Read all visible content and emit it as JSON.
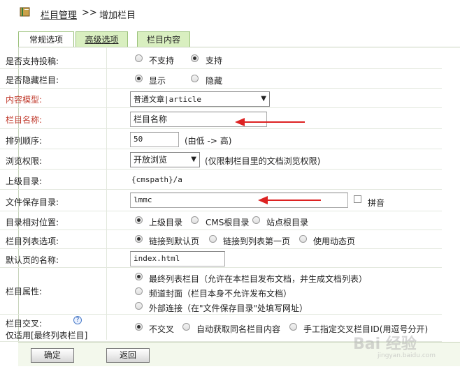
{
  "breadcrumb": {
    "section": "栏目管理",
    "separator": ">>",
    "current": "增加栏目"
  },
  "tabs": [
    "常规选项",
    "高级选项",
    "栏目内容"
  ],
  "rows": {
    "submit": {
      "label": "是否支持投稿:",
      "options": [
        "不支持",
        "支持"
      ]
    },
    "hidden": {
      "label": "是否隐藏栏目:",
      "options": [
        "显示",
        "隐藏"
      ]
    },
    "model": {
      "label": "内容模型:",
      "value": "普通文章|article"
    },
    "name": {
      "label": "栏目名称:",
      "value": "栏目名称"
    },
    "order": {
      "label": "排列顺序:",
      "value": "50",
      "hint": "(由低 -> 高)"
    },
    "perm": {
      "label": "浏览权限:",
      "value": "开放浏览",
      "hint": "(仅限制栏目里的文档浏览权限)"
    },
    "parent": {
      "label": "上级目录:",
      "value": "{cmspath}/a"
    },
    "dir": {
      "label": "文件保存目录:",
      "value": "lmmc",
      "pinyin": "拼音"
    },
    "relpos": {
      "label": "目录相对位置:",
      "options": [
        "上级目录",
        "CMS根目录",
        "站点根目录"
      ]
    },
    "listopt": {
      "label": "栏目列表选项:",
      "options": [
        "链接到默认页",
        "链接到列表第一页",
        "使用动态页"
      ]
    },
    "defpage": {
      "label": "默认页的名称:",
      "value": "index.html"
    },
    "attr": {
      "label": "栏目属性:",
      "options": [
        "最终列表栏目（允许在本栏目发布文档，并生成文档列表）",
        "频道封面（栏目本身不允许发布文档）",
        "外部连接（在\"文件保存目录\"处填写网址）"
      ]
    },
    "cross": {
      "label": "栏目交叉:",
      "sublabel": "仅适用[最终列表栏目]",
      "options": [
        "不交叉",
        "自动获取同名栏目内容",
        "手工指定交叉栏目ID(用逗号分开)"
      ]
    }
  },
  "buttons": {
    "ok": "确定",
    "back": "返回"
  },
  "watermark": {
    "text": "Bai 经验",
    "sub": "jingyan.baidu.com"
  },
  "colors": {
    "required_label": "#c0392b",
    "tab_bg": "#d9efc0",
    "annotation_arrow": "#dd2222"
  }
}
